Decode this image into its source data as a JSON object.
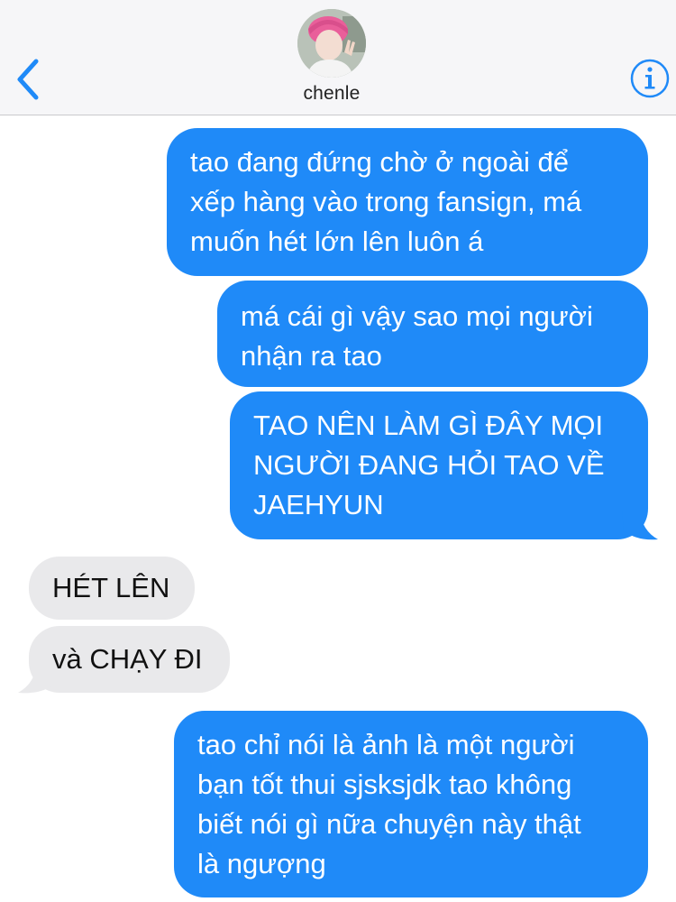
{
  "header": {
    "contact_name": "chenle",
    "back_icon": "chevron-left-icon",
    "info_icon": "info-circle-icon",
    "accent_color": "#1f8af8"
  },
  "messages": [
    {
      "direction": "outgoing",
      "text": "tao đang đứng chờ ở ngoài để\nxếp hàng vào trong fansign, má\nmuốn hét lớn lên luôn á"
    },
    {
      "direction": "outgoing",
      "text": "má cái gì vậy sao mọi người\nnhận ra tao"
    },
    {
      "direction": "outgoing",
      "text": "TAO NÊN LÀM GÌ ĐÂY MỌI\nNGƯỜI ĐANG HỎI TAO VỀ\nJAEHYUN"
    },
    {
      "direction": "incoming",
      "text": "HÉT LÊN"
    },
    {
      "direction": "incoming",
      "text": "và CHẠY ĐI"
    },
    {
      "direction": "outgoing",
      "text": "tao chỉ nói là ảnh là một người\nbạn tốt thui sjsksjdk tao không\nbiết nói gì nữa chuyện này thật\nlà ngượng"
    }
  ],
  "colors": {
    "outgoing_bubble": "#1f8af8",
    "incoming_bubble": "#e9e9eb",
    "header_background": "#f6f6f8"
  }
}
